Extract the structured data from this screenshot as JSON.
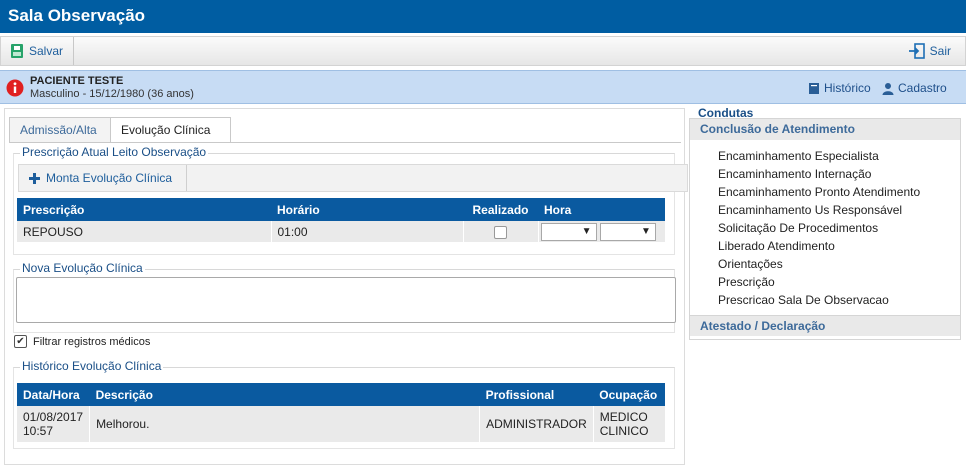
{
  "window": {
    "title": "Sala Observação"
  },
  "toolbar": {
    "save_label": "Salvar",
    "exit_label": "Sair"
  },
  "patient": {
    "name": "PACIENTE TESTE",
    "info": "Masculino - 15/12/1980 (36 anos)",
    "history_label": "Histórico",
    "register_label": "Cadastro"
  },
  "tabs": [
    {
      "label": "Admissão/Alta",
      "active": false
    },
    {
      "label": "Evolução Clínica",
      "active": true
    }
  ],
  "prescription": {
    "legend": "Prescrição Atual Leito Observação",
    "build_button": "Monta Evolução Clínica",
    "columns": [
      "Prescrição",
      "Horário",
      "Realizado",
      "Hora"
    ],
    "rows": [
      {
        "prescricao": "REPOUSO",
        "horario": "01:00",
        "realizado": false
      }
    ]
  },
  "new_evolution": {
    "legend": "Nova Evolução Clínica",
    "value": ""
  },
  "filter": {
    "label": "Filtrar registros médicos",
    "checked": true
  },
  "history": {
    "legend": "Histórico Evolução Clínica",
    "columns": [
      "Data/Hora",
      "Descrição",
      "Profissional",
      "Ocupação"
    ],
    "rows": [
      {
        "data": "01/08/2017",
        "hora": "10:57",
        "descricao": "Melhorou.",
        "profissional": "ADMINISTRADOR",
        "ocupacao_1": "MEDICO",
        "ocupacao_2": "CLINICO"
      }
    ]
  },
  "condutas": {
    "title": "Condutas",
    "section1": "Conclusão de Atendimento",
    "items": [
      "Encaminhamento Especialista",
      "Encaminhamento Internação",
      "Encaminhamento Pronto Atendimento",
      "Encaminhamento Us Responsável",
      "Solicitação De Procedimentos",
      "Liberado Atendimento",
      "Orientações",
      "Prescrição",
      "Prescricao Sala De Observacao"
    ],
    "section2": "Atestado / Declaração"
  },
  "colors": {
    "primary": "#005da2",
    "header": "#0a5aa0",
    "patient_bar": "#c7dcf4",
    "alert": "#e02020"
  },
  "icons": {
    "save": "save-icon",
    "exit": "exit-icon",
    "alert": "alert-icon",
    "history": "book-icon",
    "register": "user-icon",
    "add": "plus-icon"
  }
}
